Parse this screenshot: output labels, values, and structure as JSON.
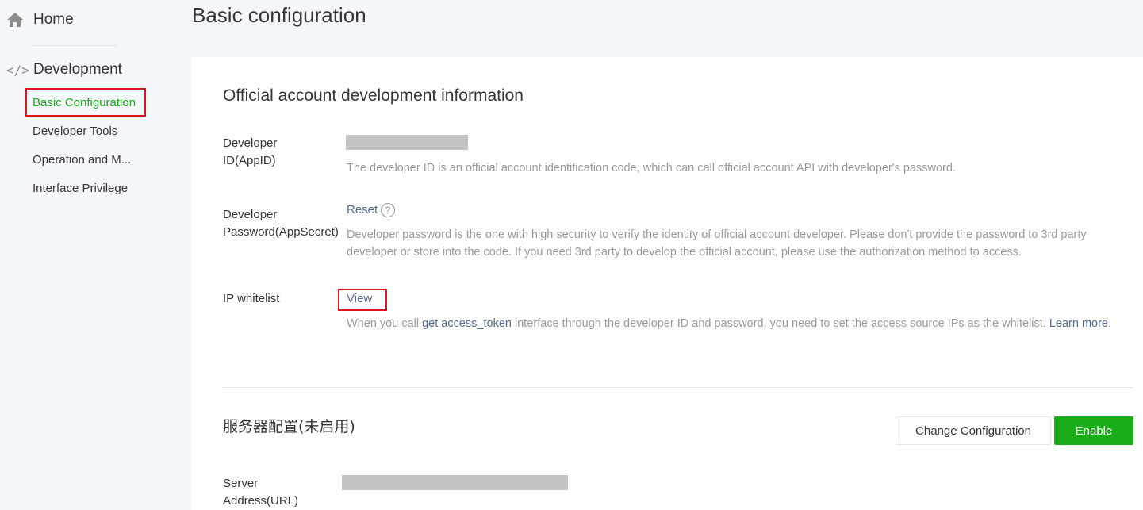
{
  "sidebar": {
    "home_label": "Home",
    "development_label": "Development",
    "code_icon_glyph": "</>",
    "items": [
      {
        "label": "Basic Configuration",
        "active": true
      },
      {
        "label": "Developer Tools"
      },
      {
        "label": "Operation and M..."
      },
      {
        "label": "Interface Privilege"
      }
    ]
  },
  "page": {
    "title": "Basic configuration"
  },
  "dev_info": {
    "section_title": "Official account development information",
    "app_id": {
      "label_line1": "Developer",
      "label_line2": "ID(AppID)",
      "description": "The developer ID is an official account identification code, which can call official account API with developer's password."
    },
    "app_secret": {
      "label_line1": "Developer",
      "label_line2": "Password(AppSecret)",
      "action_label": "Reset",
      "help_glyph": "?",
      "description": "Developer password is the one with high security to verify the identity of official account developer. Please don't provide the password to 3rd party developer or store into the code. If you need 3rd party to develop the official account, please use the authorization method to access."
    },
    "ip_whitelist": {
      "label": "IP whitelist",
      "action_label": "View",
      "desc_prefix": "When you call ",
      "desc_link": "get access_token",
      "desc_middle": " interface through the developer ID and password, you need to set the access source IPs as the whitelist. ",
      "desc_learn_more": "Learn more."
    }
  },
  "server_config": {
    "section_title": "服务器配置(未启用)",
    "change_button_label": "Change Configuration",
    "enable_button_label": "Enable",
    "server_url": {
      "label_line1": "Server",
      "label_line2": "Address(URL)"
    }
  },
  "colors": {
    "accent_green": "#1aad19",
    "link_blue": "#576b95",
    "highlight_red": "#e0141e"
  }
}
